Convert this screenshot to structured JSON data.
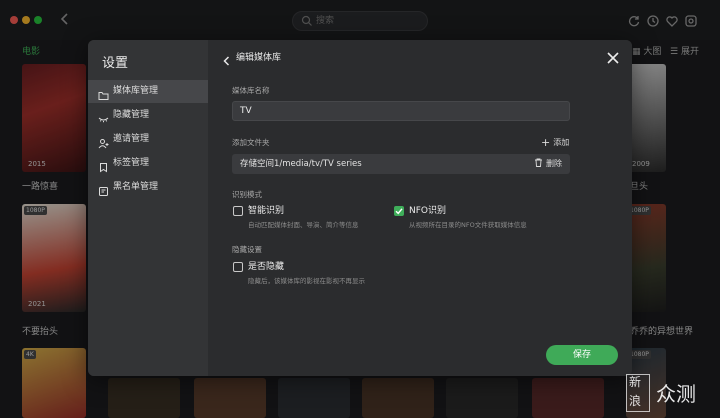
{
  "window": {
    "search_placeholder": "搜索"
  },
  "background": {
    "section_label": "电影",
    "opt_large": "大图",
    "opt_expand": "展开",
    "posters": [
      {
        "title": "一路惊喜",
        "year": "2015"
      },
      {
        "title": "不要抬头",
        "year": "2021",
        "tag": "1080P"
      },
      {
        "title": "",
        "tag": "4K"
      },
      {
        "title": "旦头",
        "year": "2009"
      },
      {
        "title": "乔乔的异想世界",
        "tag": "1080P"
      },
      {
        "title": "",
        "tag": "1080P"
      }
    ]
  },
  "modal": {
    "title": "设置",
    "sidebar": [
      {
        "label": "媒体库管理",
        "icon": "folder-icon",
        "active": true
      },
      {
        "label": "隐藏管理",
        "icon": "eye-hidden-icon",
        "active": false
      },
      {
        "label": "邀请管理",
        "icon": "user-add-icon",
        "active": false
      },
      {
        "label": "标签管理",
        "icon": "bookmark-icon",
        "active": false
      },
      {
        "label": "黑名单管理",
        "icon": "blocklist-icon",
        "active": false
      }
    ],
    "header_title": "编辑媒体库",
    "name_label": "媒体库名称",
    "name_value": "TV",
    "folder_label": "添加文件夹",
    "add_label": "添加",
    "folder_path": "存储空间1/media/tv/TV series",
    "delete_label": "删除",
    "recog_label": "识别模式",
    "opt_smart": "智能识别",
    "opt_smart_desc": "自动匹配媒体封面、导演、简介等信息",
    "opt_smart_checked": false,
    "opt_nfo": "NFO识别",
    "opt_nfo_desc": "从视频所在目录的NFO文件获取媒体信息",
    "opt_nfo_checked": true,
    "hide_label": "隐藏设置",
    "opt_hide": "是否隐藏",
    "opt_hide_desc": "隐藏后，该媒体库的影视在影视不再显示",
    "opt_hide_checked": false,
    "save_label": "保存"
  },
  "watermark": {
    "line1": "新",
    "line2": "浪",
    "text": "众测"
  },
  "colors": {
    "accent": "#3faa58",
    "sidebar_active": "#46474a"
  }
}
